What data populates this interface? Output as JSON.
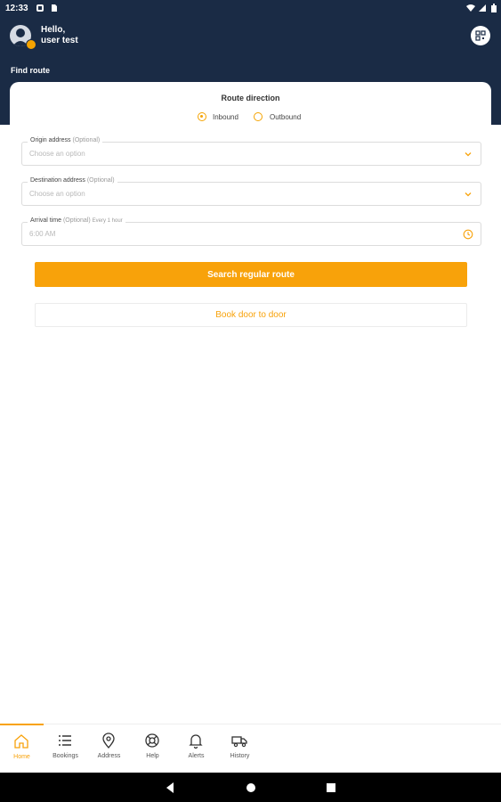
{
  "status_bar": {
    "time": "12:33"
  },
  "header": {
    "greeting_line1": "Hello,",
    "greeting_line2": "user test",
    "section_title": "Find route"
  },
  "route_direction": {
    "title": "Route direction",
    "options": [
      {
        "label": "Inbound",
        "selected": true
      },
      {
        "label": "Outbound",
        "selected": false
      }
    ]
  },
  "form": {
    "origin": {
      "label": "Origin address",
      "optional": "(Optional)",
      "placeholder": "Choose an option"
    },
    "destination": {
      "label": "Destination address",
      "optional": "(Optional)",
      "placeholder": "Choose an option"
    },
    "arrival": {
      "label": "Arrival time",
      "optional": "(Optional)",
      "hint": "Every 1 hour",
      "value": "6:00 AM"
    }
  },
  "buttons": {
    "search": "Search regular route",
    "book": "Book door to door"
  },
  "bottom_nav": {
    "active": "Home",
    "items": [
      {
        "label": "Home",
        "icon": "home-icon"
      },
      {
        "label": "Bookings",
        "icon": "list-icon"
      },
      {
        "label": "Address",
        "icon": "location-pin-icon"
      },
      {
        "label": "Help",
        "icon": "lifebuoy-icon"
      },
      {
        "label": "Alerts",
        "icon": "bell-icon"
      },
      {
        "label": "History",
        "icon": "truck-icon"
      }
    ]
  },
  "colors": {
    "header_bg": "#1a2b45",
    "accent": "#f8a20a",
    "text": "#333333",
    "muted": "#b8b8b8"
  }
}
